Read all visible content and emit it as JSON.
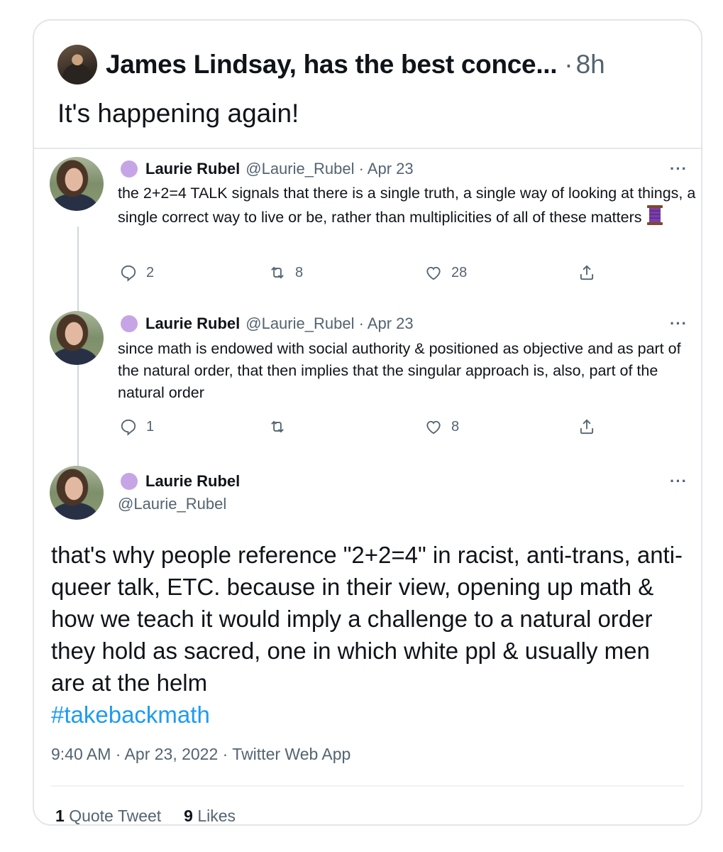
{
  "quote": {
    "author": "James Lindsay, has the best conce...",
    "separator": "·",
    "time": "8h",
    "text": "It's happening again!"
  },
  "tweets": [
    {
      "name": "Laurie Rubel",
      "handle_date": "@Laurie_Rubel · Apr 23",
      "text": "the 2+2=4 TALK signals that there is a single truth, a single way of looking at things, a single correct way to live or be, rather than multiplicities of all of these matters",
      "emoji": "spool-of-thread",
      "replies": "2",
      "retweets": "8",
      "likes": "28"
    },
    {
      "name": "Laurie Rubel",
      "handle_date": "@Laurie_Rubel · Apr 23",
      "text": "since math is endowed with social authority & positioned as objective and as part of the natural order, that then implies that the singular approach is, also, part of the natural order",
      "replies": "1",
      "retweets": "",
      "likes": "8"
    }
  ],
  "main_tweet": {
    "name": "Laurie Rubel",
    "handle": "@Laurie_Rubel",
    "text": "that's why people reference \"2+2=4\" in racist, anti-trans, anti-queer talk, ETC. because in their view, opening up math & how we teach it would imply a challenge to a natural order they hold as sacred, one in which white ppl & usually men are at the helm",
    "hashtag": "#takebackmath",
    "meta": "9:40 AM · Apr 23, 2022 · Twitter Web App",
    "quote_count": "1",
    "quote_label": "Quote Tweet",
    "likes_count": "9",
    "likes_label": "Likes"
  },
  "more_label": "···",
  "colors": {
    "accent": "#1d9bf0",
    "muted": "#536471",
    "badge": "#c6a5e6"
  }
}
